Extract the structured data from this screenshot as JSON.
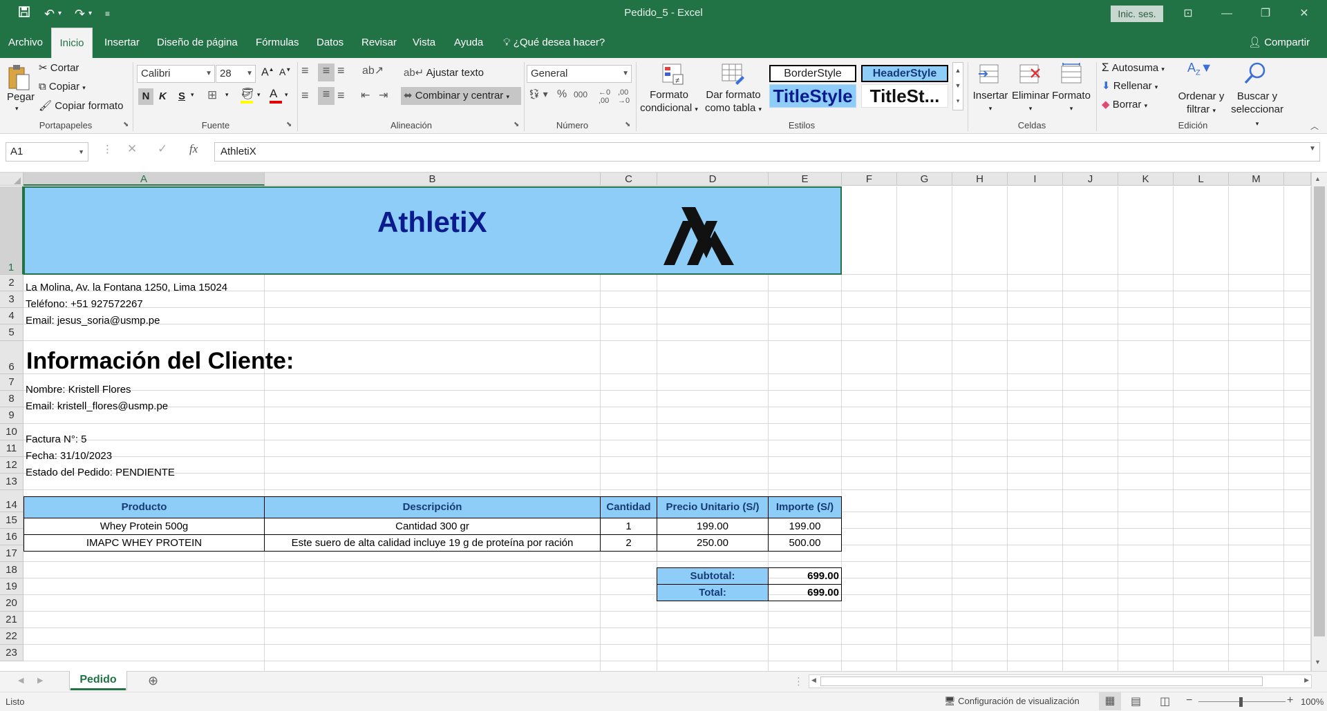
{
  "app": {
    "title": "Pedido_5  -  Excel",
    "signin": "Inic. ses.",
    "share": "Compartir"
  },
  "tabs": [
    "Archivo",
    "Inicio",
    "Insertar",
    "Diseño de página",
    "Fórmulas",
    "Datos",
    "Revisar",
    "Vista",
    "Ayuda"
  ],
  "tell_me": "¿Qué desea hacer?",
  "ribbon": {
    "portapapeles": {
      "pegar": "Pegar",
      "cortar": "Cortar",
      "copiar": "Copiar",
      "copiar_formato": "Copiar formato",
      "label": "Portapapeles"
    },
    "fuente": {
      "font": "Calibri",
      "size": "28",
      "bold": "N",
      "italic": "K",
      "underline": "S",
      "label": "Fuente"
    },
    "alineacion": {
      "ajustar": "Ajustar texto",
      "combinar": "Combinar y centrar",
      "label": "Alineación"
    },
    "numero": {
      "format": "General",
      "label": "Número"
    },
    "estilos": {
      "formato_condicional": "Formato condicional",
      "dar_formato": "Dar formato como tabla",
      "s1": "BorderStyle",
      "s2": "HeaderStyle",
      "s3": "TitleStyle",
      "s4": "TitleSt...",
      "label": "Estilos"
    },
    "celdas": {
      "insertar": "Insertar",
      "eliminar": "Eliminar",
      "formato": "Formato",
      "label": "Celdas"
    },
    "edicion": {
      "autosuma": "Autosuma",
      "rellenar": "Rellenar",
      "borrar": "Borrar",
      "ordenar": "Ordenar y filtrar",
      "buscar": "Buscar y seleccionar",
      "label": "Edición"
    }
  },
  "formula": {
    "cell_ref": "A1",
    "content": "AthletiX"
  },
  "columns": [
    "A",
    "B",
    "C",
    "D",
    "E",
    "F",
    "G",
    "H",
    "I",
    "J",
    "K",
    "L",
    "M"
  ],
  "rows": [
    "1",
    "2",
    "3",
    "4",
    "5",
    "6",
    "7",
    "8",
    "9",
    "10",
    "11",
    "12",
    "13",
    "14",
    "15",
    "16",
    "17",
    "18",
    "19",
    "20",
    "21",
    "22",
    "23"
  ],
  "sheet": {
    "brand": "AthletiX",
    "address": "La Molina, Av. la Fontana 1250, Lima 15024",
    "phone": "Teléfono: +51 927572267",
    "email": "Email: jesus_soria@usmp.pe",
    "client_header": "Información del Cliente:",
    "client_name": "Nombre: Kristell Flores",
    "client_email": "Email: kristell_flores@usmp.pe",
    "invoice": "Factura N°: 5",
    "date": "Fecha: 31/10/2023",
    "status": "Estado del Pedido: PENDIENTE",
    "table_headers": [
      "Producto",
      "Descripción",
      "Cantidad",
      "Precio Unitario (S/)",
      "Importe (S/)"
    ],
    "items": [
      [
        "Whey Protein 500g",
        "Cantidad 300 gr",
        "1",
        "199.00",
        "199.00"
      ],
      [
        "IMAPC WHEY PROTEIN",
        "Este suero de alta calidad incluye 19 g de proteína por ración",
        "2",
        "250.00",
        "500.00"
      ]
    ],
    "subtotal_label": "Subtotal:",
    "subtotal": "699.00",
    "total_label": "Total:",
    "total": "699.00"
  },
  "sheet_tab": "Pedido",
  "status": {
    "ready": "Listo",
    "display_settings": "Configuración de visualización",
    "zoom": "100%"
  },
  "colors": {
    "excel_green": "#217346",
    "header_fill": "#8dcdf7",
    "brand_text": "#0b1a8c"
  }
}
